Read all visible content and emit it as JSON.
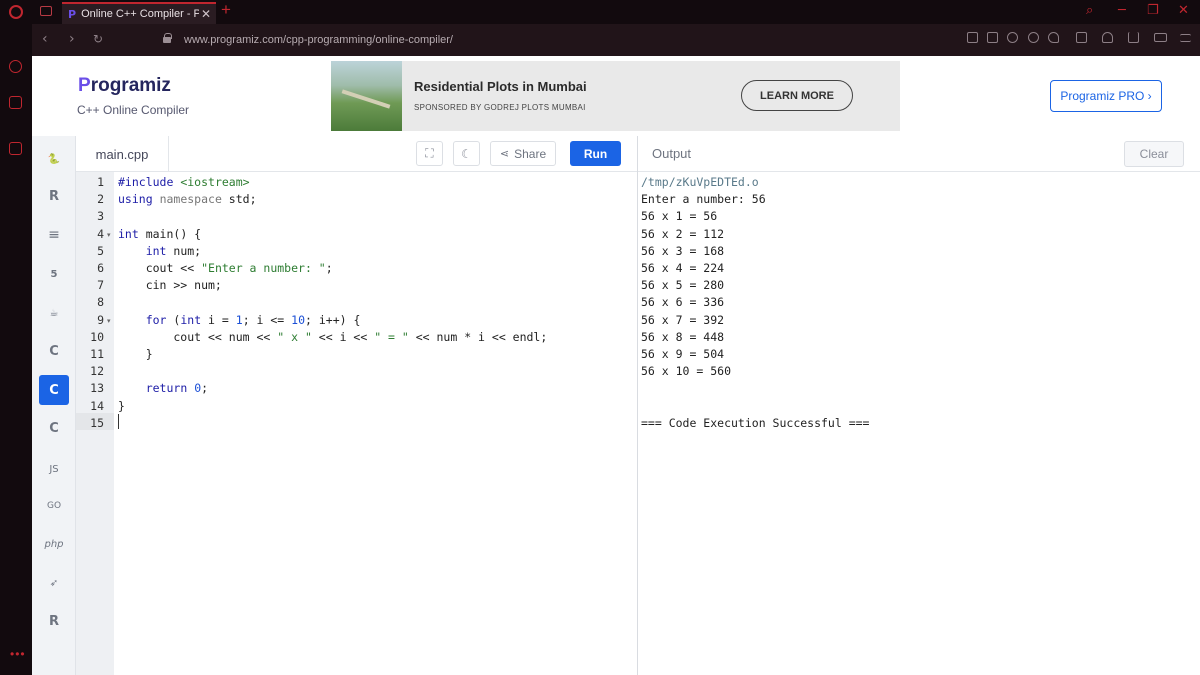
{
  "browser": {
    "tab_title": "Online C++ Compiler - Pro",
    "url": "www.programiz.com/cpp-programming/online-compiler/"
  },
  "header": {
    "brand": "rogramiz",
    "brand_initial": "P",
    "subtitle": "C++ Online Compiler",
    "pro_button": "Programiz PRO ›"
  },
  "ad": {
    "title": "Residential Plots in Mumbai",
    "sponsor": "SPONSORED BY GODREJ PLOTS MUMBAI",
    "cta": "LEARN MORE"
  },
  "languages": [
    "python",
    "r",
    "sql",
    "html",
    "java",
    "c",
    "cpp",
    "csharp",
    "js",
    "go",
    "php",
    "swift",
    "rust"
  ],
  "active_language": "cpp",
  "editor": {
    "file_name": "main.cpp",
    "share_label": "Share",
    "run_label": "Run",
    "lines": [
      "#include <iostream>",
      "using namespace std;",
      "",
      "int main() {",
      "    int num;",
      "    cout << \"Enter a number: \";",
      "    cin >> num;",
      "",
      "    for (int i = 1; i <= 10; i++) {",
      "        cout << num << \" x \" << i << \" = \" << num * i << endl;",
      "    }",
      "",
      "    return 0;",
      "}",
      ""
    ]
  },
  "output": {
    "title": "Output",
    "clear_label": "Clear",
    "lines": [
      "/tmp/zKuVpEDTEd.o",
      "Enter a number: 56",
      "56 x 1 = 56",
      "56 x 2 = 112",
      "56 x 3 = 168",
      "56 x 4 = 224",
      "56 x 5 = 280",
      "56 x 6 = 336",
      "56 x 7 = 392",
      "56 x 8 = 448",
      "56 x 9 = 504",
      "56 x 10 = 560",
      "",
      "",
      "=== Code Execution Successful ==="
    ]
  },
  "colors": {
    "accent": "#1b64e5",
    "browser_red": "#c0262f",
    "code_keyword": "#1d1da7",
    "code_string": "#2e7d32",
    "code_number": "#1b4fd6"
  }
}
